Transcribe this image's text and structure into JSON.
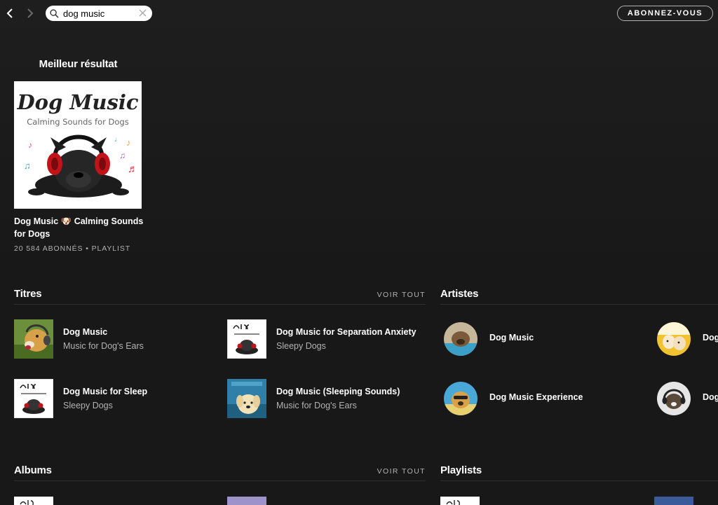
{
  "header": {
    "back_icon": "chevron-left-icon",
    "forward_icon": "chevron-right-icon",
    "search": {
      "value": "dog music",
      "icon": "search-icon",
      "clear_icon": "close-icon"
    },
    "subscribe_label": "ABONNEZ-VOUS"
  },
  "best_result": {
    "heading": "Meilleur résultat",
    "cover": {
      "title_art": "Dog Music",
      "subtitle_art": "Calming Sounds for Dogs"
    },
    "title": "Dog Music 🐶 Calming Sounds for Dogs",
    "meta": "20 584 ABONNÉS • PLAYLIST"
  },
  "sections": {
    "titles": {
      "heading": "Titres",
      "see_all": "VOIR TOUT"
    },
    "artists": {
      "heading": "Artistes"
    },
    "albums": {
      "heading": "Albums",
      "see_all": "VOIR TOUT"
    },
    "playlists": {
      "heading": "Playlists"
    }
  },
  "tracks": [
    {
      "title": "Dog Music",
      "subtitle": "Music for Dog's Ears"
    },
    {
      "title": "Dog Music for Separation Anxiety",
      "subtitle": "Sleepy Dogs"
    },
    {
      "title": "Dog Music for Sleep",
      "subtitle": "Sleepy Dogs"
    },
    {
      "title": "Dog Music (Sleeping Sounds)",
      "subtitle": "Music for Dog's Ears"
    }
  ],
  "artists": [
    {
      "name": "Dog Music"
    },
    {
      "name": "Dog Music Experience"
    },
    {
      "name": "Dog"
    },
    {
      "name": "Dog"
    }
  ],
  "colors": {
    "background": "#181818",
    "text_secondary": "#b3b3b3",
    "divider": "#2e2e2e"
  }
}
